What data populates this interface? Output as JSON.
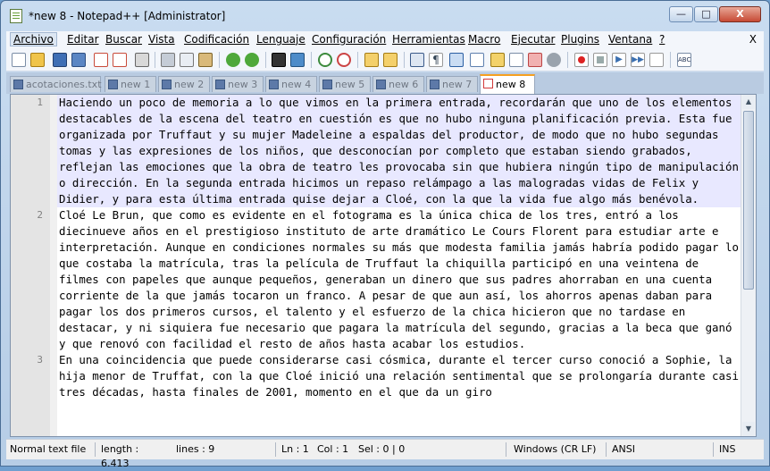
{
  "window": {
    "title": "*new 8 - Notepad++ [Administrator]",
    "controls": {
      "minimize": "—",
      "maximize": "□",
      "close": "X"
    }
  },
  "menu": {
    "items": [
      "Archivo",
      "Editar",
      "Buscar",
      "Vista",
      "Codificación",
      "Lenguaje",
      "Configuración",
      "Herramientas",
      "Macro",
      "Ejecutar",
      "Plugins",
      "Ventana",
      "?"
    ],
    "close_label": "X"
  },
  "toolbar": {
    "icons": [
      "new-icon",
      "open-icon",
      "save-icon",
      "save-all-icon",
      "close-icon",
      "close-all-icon",
      "print-icon",
      "cut-icon",
      "copy-icon",
      "paste-icon",
      "undo-icon",
      "redo-icon",
      "find-icon",
      "replace-icon",
      "zoom-in-icon",
      "zoom-out-icon",
      "sync-v-icon",
      "sync-h-icon",
      "word-wrap-icon",
      "show-all-chars-icon",
      "indent-guide-icon",
      "doc-map-icon",
      "function-list-icon",
      "folder-icon",
      "monitor-icon",
      "record-icon",
      "stop-icon",
      "play-icon",
      "play-multi-icon",
      "save-macro-icon",
      "spellcheck-icon"
    ]
  },
  "tabs": [
    {
      "label": "acotaciones.txt",
      "active": false
    },
    {
      "label": "new 1",
      "active": false
    },
    {
      "label": "new 2",
      "active": false
    },
    {
      "label": "new 3",
      "active": false
    },
    {
      "label": "new 4",
      "active": false
    },
    {
      "label": "new 5",
      "active": false
    },
    {
      "label": "new 6",
      "active": false
    },
    {
      "label": "new 7",
      "active": false
    },
    {
      "label": "new 8",
      "active": true
    }
  ],
  "editor": {
    "lines": [
      {
        "number": "1",
        "text": "Haciendo un poco de memoria a lo que vimos en la primera entrada, recordarán que uno de los elementos destacables de la escena del teatro en cuestión es que no hubo ninguna planificación previa. Esta fue organizada por Truffaut y su mujer Madeleine a espaldas del productor, de modo que no hubo segundas tomas y las expresiones de los niños, que desconocían por completo que estaban siendo grabados, reflejan las emociones que la obra de teatro les provocaba sin que hubiera ningún tipo de manipulación o dirección. En la segunda entrada hicimos un repaso relámpago a las malogradas vidas de Felix y Didier, y para esta última entrada quise dejar a Cloé, con la que la vida fue algo más benévola."
      },
      {
        "number": "2",
        "text": "Cloé Le Brun, que como es evidente en el fotograma es la única chica de los tres, entró a los diecinueve años en el prestigioso instituto de arte dramático Le Cours Florent para estudiar arte e interpretación. Aunque en condiciones normales su más que modesta familia jamás habría podido pagar lo que costaba la matrícula, tras la película de Truffaut la chiquilla participó en una veintena de filmes con papeles que aunque pequeños, generaban un dinero que sus padres ahorraban en una cuenta corriente de la que jamás tocaron un franco. A pesar de que aun así, los ahorros apenas daban para pagar los dos primeros cursos, el talento y el esfuerzo de la chica hicieron que no tardase en destacar, y ni siquiera fue necesario que pagara la matrícula del segundo, gracias a la beca que ganó y que renovó con facilidad el resto de años hasta acabar los estudios."
      },
      {
        "number": "3",
        "text": "En una coincidencia que puede considerarse casi cósmica, durante el tercer curso conoció a Sophie, la hija menor de Truffat, con la que Cloé inició una relación sentimental que se prolongaría durante casi tres décadas, hasta finales de 2001, momento en el que da un giro"
      }
    ]
  },
  "status": {
    "file_type": "Normal text file",
    "length": "length : 6.413",
    "lines": "lines : 9",
    "ln": "Ln : 1",
    "col": "Col : 1",
    "sel": "Sel : 0 | 0",
    "eol": "Windows (CR LF)",
    "encoding": "ANSI",
    "mode": "INS"
  }
}
